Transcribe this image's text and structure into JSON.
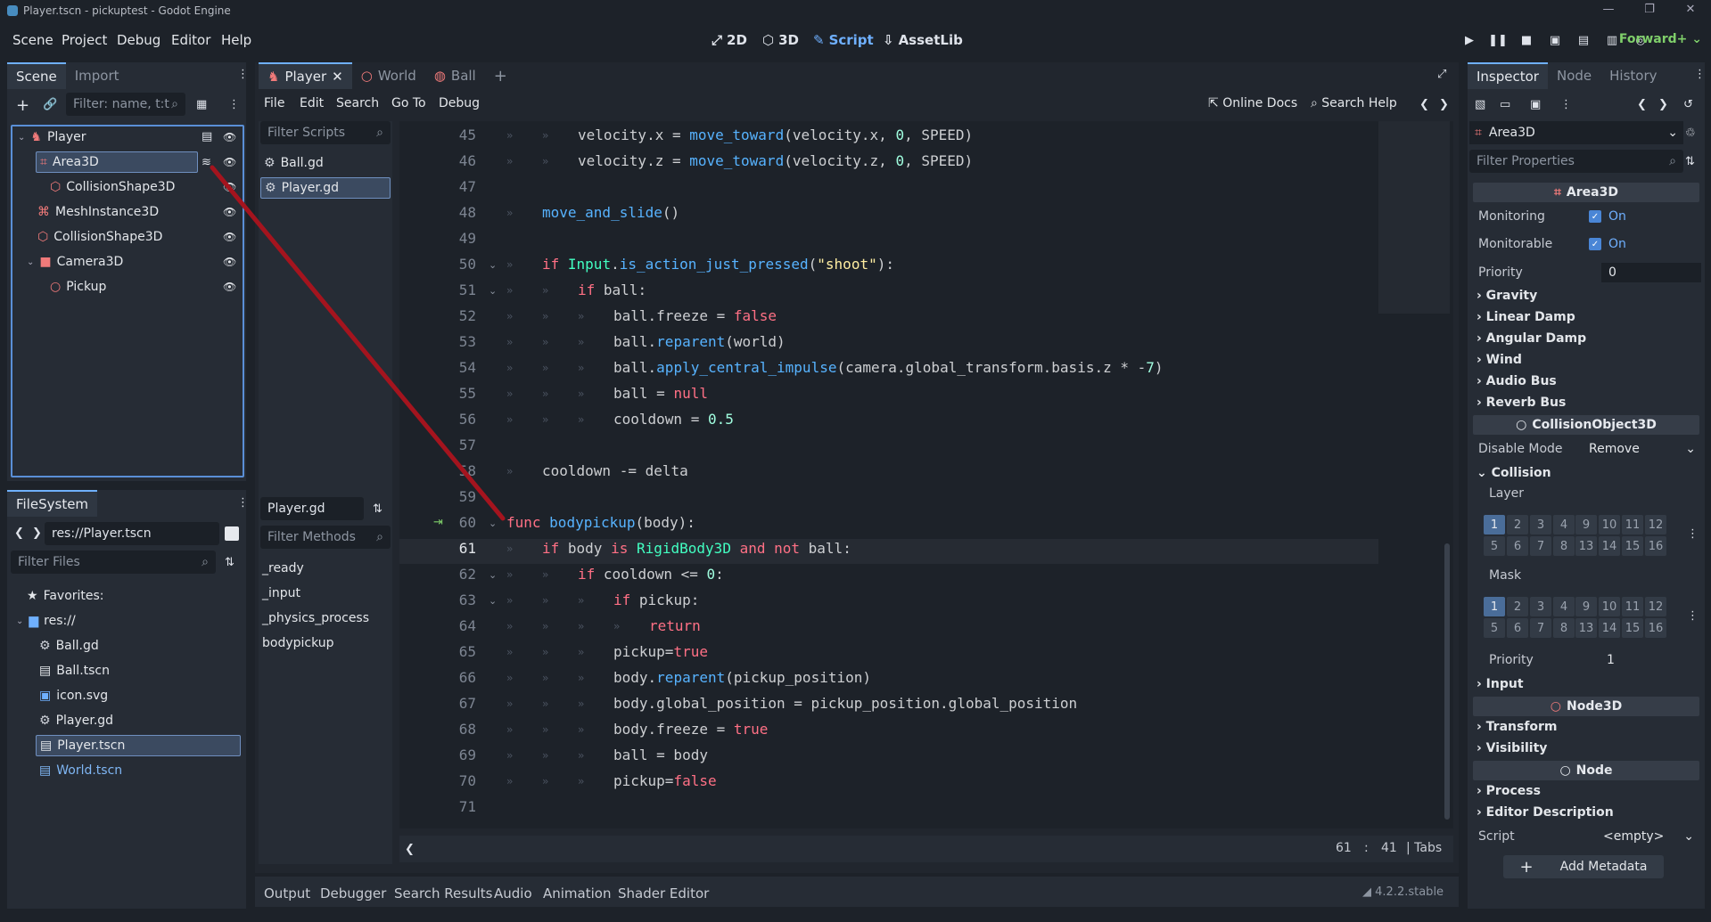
{
  "window": {
    "title": "Player.tscn - pickuptest - Godot Engine",
    "controls": [
      "—",
      "❐",
      "✕"
    ]
  },
  "menu": [
    "Scene",
    "Project",
    "Debug",
    "Editor",
    "Help"
  ],
  "main_screens": [
    {
      "label": "2D",
      "icon": "2d-icon"
    },
    {
      "label": "3D",
      "icon": "3d-icon"
    },
    {
      "label": "Script",
      "icon": "script-icon",
      "active": true
    },
    {
      "label": "AssetLib",
      "icon": "assetlib-icon"
    }
  ],
  "renderer": "Forward+",
  "scene_dock": {
    "tabs": [
      "Scene",
      "Import"
    ],
    "filter_placeholder": "Filter: name, t:t",
    "tree": [
      {
        "label": "Player",
        "icon": "character-body-icon",
        "depth": 0
      },
      {
        "label": "Area3D",
        "icon": "area3d-icon",
        "depth": 1,
        "selected": true
      },
      {
        "label": "CollisionShape3D",
        "icon": "collision-shape-icon",
        "depth": 2
      },
      {
        "label": "MeshInstance3D",
        "icon": "mesh-instance-icon",
        "depth": 1
      },
      {
        "label": "CollisionShape3D",
        "icon": "collision-shape-icon",
        "depth": 1
      },
      {
        "label": "Camera3D",
        "icon": "camera-icon",
        "depth": 1
      },
      {
        "label": "Pickup",
        "icon": "node3d-icon",
        "depth": 2
      }
    ]
  },
  "filesystem_dock": {
    "tab": "FileSystem",
    "path": "res://Player.tscn",
    "filter_placeholder": "Filter Files",
    "items": [
      {
        "label": "Favorites:",
        "icon": "star-icon",
        "depth": 0
      },
      {
        "label": "res://",
        "icon": "folder-icon",
        "depth": 0
      },
      {
        "label": "Ball.gd",
        "icon": "gear-icon",
        "depth": 1
      },
      {
        "label": "Ball.tscn",
        "icon": "scene-icon",
        "depth": 1
      },
      {
        "label": "icon.svg",
        "icon": "image-icon",
        "depth": 1
      },
      {
        "label": "Player.gd",
        "icon": "gear-icon",
        "depth": 1
      },
      {
        "label": "Player.tscn",
        "icon": "scene-icon",
        "depth": 1,
        "selected": true
      },
      {
        "label": "World.tscn",
        "icon": "scene-icon",
        "depth": 1,
        "link": true
      }
    ]
  },
  "editor_tabs": [
    {
      "label": "Player",
      "active": true
    },
    {
      "label": "World"
    },
    {
      "label": "Ball"
    }
  ],
  "script_menu": [
    "File",
    "Edit",
    "Search",
    "Go To",
    "Debug"
  ],
  "script_toolbar": {
    "online_docs": "Online Docs",
    "search_help": "Search Help"
  },
  "scripts_panel": {
    "filter_placeholder": "Filter Scripts",
    "items": [
      "Ball.gd",
      "Player.gd"
    ],
    "selected": "Player.gd",
    "current_label": "Player.gd",
    "methods_placeholder": "Filter Methods",
    "methods": [
      "_ready",
      "_input",
      "_physics_process",
      "bodypickup"
    ]
  },
  "code_lines": [
    {
      "n": "45",
      "indent": 2,
      "tokens": [
        [
          "tx",
          "velocity.x = "
        ],
        [
          "fn",
          "move_toward"
        ],
        [
          "tx",
          "(velocity.x, "
        ],
        [
          "nm",
          "0"
        ],
        [
          "tx",
          ", SPEED)"
        ]
      ]
    },
    {
      "n": "46",
      "indent": 2,
      "tokens": [
        [
          "tx",
          "velocity.z = "
        ],
        [
          "fn",
          "move_toward"
        ],
        [
          "tx",
          "(velocity.z, "
        ],
        [
          "nm",
          "0"
        ],
        [
          "tx",
          ", SPEED)"
        ]
      ]
    },
    {
      "n": "47",
      "indent": 0,
      "tokens": []
    },
    {
      "n": "48",
      "indent": 1,
      "tokens": [
        [
          "fn",
          "move_and_slide"
        ],
        [
          "tx",
          "()"
        ]
      ]
    },
    {
      "n": "49",
      "indent": 0,
      "tokens": []
    },
    {
      "n": "50",
      "indent": 1,
      "fold": true,
      "tokens": [
        [
          "kw",
          "if "
        ],
        [
          "cl",
          "Input"
        ],
        [
          "tx",
          "."
        ],
        [
          "fn",
          "is_action_just_pressed"
        ],
        [
          "tx",
          "("
        ],
        [
          "st",
          "\"shoot\""
        ],
        [
          "tx",
          "):"
        ]
      ]
    },
    {
      "n": "51",
      "indent": 2,
      "fold": true,
      "tokens": [
        [
          "kw",
          "if "
        ],
        [
          "tx",
          "ball:"
        ]
      ]
    },
    {
      "n": "52",
      "indent": 3,
      "tokens": [
        [
          "tx",
          "ball.freeze = "
        ],
        [
          "kw",
          "false"
        ]
      ]
    },
    {
      "n": "53",
      "indent": 3,
      "tokens": [
        [
          "tx",
          "ball."
        ],
        [
          "fn",
          "reparent"
        ],
        [
          "tx",
          "(world)"
        ]
      ]
    },
    {
      "n": "54",
      "indent": 3,
      "tokens": [
        [
          "tx",
          "ball."
        ],
        [
          "fn",
          "apply_central_impulse"
        ],
        [
          "tx",
          "(camera.global_transform.basis.z * -"
        ],
        [
          "nm",
          "7"
        ],
        [
          "tx",
          ")"
        ]
      ]
    },
    {
      "n": "55",
      "indent": 3,
      "tokens": [
        [
          "tx",
          "ball = "
        ],
        [
          "kw",
          "null"
        ]
      ]
    },
    {
      "n": "56",
      "indent": 3,
      "tokens": [
        [
          "tx",
          "cooldown = "
        ],
        [
          "nm",
          "0.5"
        ]
      ]
    },
    {
      "n": "57",
      "indent": 0,
      "tokens": []
    },
    {
      "n": "58",
      "indent": 1,
      "tokens": [
        [
          "tx",
          "cooldown -= delta"
        ]
      ]
    },
    {
      "n": "59",
      "indent": 0,
      "tokens": []
    },
    {
      "n": "60",
      "indent": 0,
      "fold": true,
      "marker": true,
      "tokens": [
        [
          "kw",
          "func "
        ],
        [
          "fn",
          "bodypickup"
        ],
        [
          "tx",
          "(body):"
        ]
      ]
    },
    {
      "n": "61",
      "indent": 1,
      "current": true,
      "tokens": [
        [
          "kw",
          "if "
        ],
        [
          "tx",
          "body "
        ],
        [
          "kw",
          "is "
        ],
        [
          "cl",
          "RigidBody3D"
        ],
        [
          "kw",
          " and not "
        ],
        [
          "tx",
          "ball:"
        ]
      ]
    },
    {
      "n": "62",
      "indent": 2,
      "fold": true,
      "tokens": [
        [
          "kw",
          "if "
        ],
        [
          "tx",
          "cooldown <= "
        ],
        [
          "nm",
          "0"
        ],
        [
          "tx",
          ":"
        ]
      ]
    },
    {
      "n": "63",
      "indent": 3,
      "fold": true,
      "tokens": [
        [
          "kw",
          "if "
        ],
        [
          "tx",
          "pickup:"
        ]
      ]
    },
    {
      "n": "64",
      "indent": 4,
      "tokens": [
        [
          "kw",
          "return"
        ]
      ]
    },
    {
      "n": "65",
      "indent": 3,
      "tokens": [
        [
          "tx",
          "pickup="
        ],
        [
          "kw",
          "true"
        ]
      ]
    },
    {
      "n": "66",
      "indent": 3,
      "tokens": [
        [
          "tx",
          "body."
        ],
        [
          "fn",
          "reparent"
        ],
        [
          "tx",
          "(pickup_position)"
        ]
      ]
    },
    {
      "n": "67",
      "indent": 3,
      "tokens": [
        [
          "tx",
          "body.global_position = pickup_position.global_position"
        ]
      ]
    },
    {
      "n": "68",
      "indent": 3,
      "tokens": [
        [
          "tx",
          "body.freeze = "
        ],
        [
          "kw",
          "true"
        ]
      ]
    },
    {
      "n": "69",
      "indent": 3,
      "tokens": [
        [
          "tx",
          "ball = body"
        ]
      ]
    },
    {
      "n": "70",
      "indent": 3,
      "tokens": [
        [
          "tx",
          "pickup="
        ],
        [
          "kw",
          "false"
        ]
      ]
    },
    {
      "n": "71",
      "indent": 0,
      "tokens": []
    }
  ],
  "status": {
    "line": "61",
    "sep": ":",
    "col": "41",
    "indent": "Tabs"
  },
  "bottom_tabs": [
    "Output",
    "Debugger",
    "Search Results",
    "Audio",
    "Animation",
    "Shader Editor"
  ],
  "version": "4.2.2.stable",
  "inspector": {
    "tabs": [
      "Inspector",
      "Node",
      "History"
    ],
    "object": "Area3D",
    "filter_placeholder": "Filter Properties",
    "header_area3d": "Area3D",
    "monitoring": {
      "label": "Monitoring",
      "value": "On"
    },
    "monitorable": {
      "label": "Monitorable",
      "value": "On"
    },
    "priority": {
      "label": "Priority",
      "value": "0"
    },
    "sections_a": [
      "Gravity",
      "Linear Damp",
      "Angular Damp",
      "Wind",
      "Audio Bus",
      "Reverb Bus"
    ],
    "header_collision": "CollisionObject3D",
    "disable_mode": {
      "label": "Disable Mode",
      "value": "Remove"
    },
    "collision": "Collision",
    "layer_label": "Layer",
    "mask_label": "Mask",
    "layer_bits": [
      "1",
      "2",
      "3",
      "4",
      "9",
      "10",
      "11",
      "12",
      "5",
      "6",
      "7",
      "8",
      "13",
      "14",
      "15",
      "16"
    ],
    "collision_priority": {
      "label": "Priority",
      "value": "1"
    },
    "input": "Input",
    "header_node3d": "Node3D",
    "sections_b": [
      "Transform",
      "Visibility"
    ],
    "header_node": "Node",
    "sections_c": [
      "Process",
      "Editor Description"
    ],
    "script": {
      "label": "Script",
      "value": "<empty>"
    },
    "add_metadata": "Add Metadata"
  }
}
